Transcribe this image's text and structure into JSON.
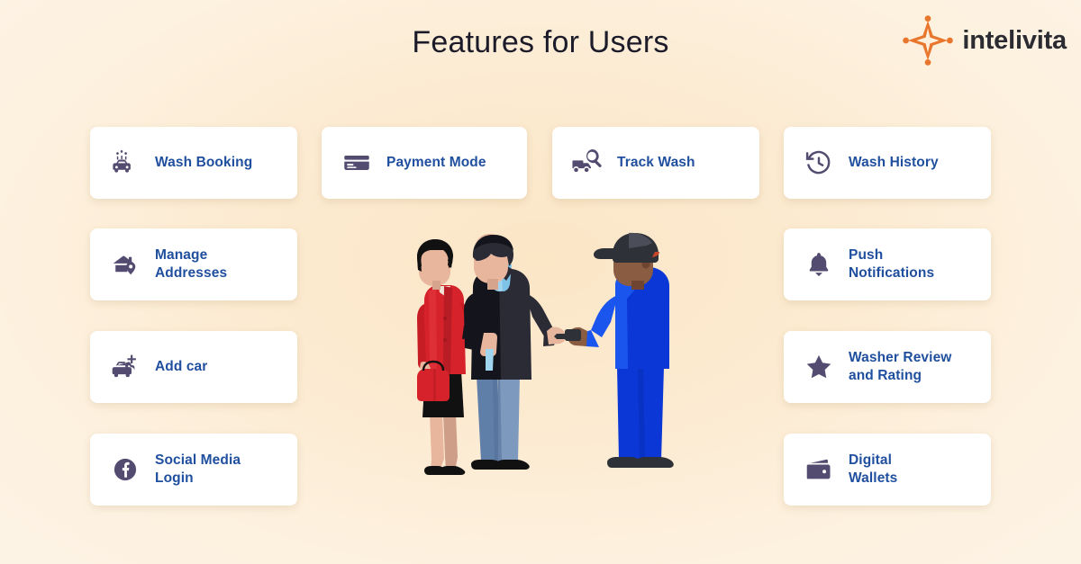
{
  "header": {
    "title": "Features for Users",
    "logo": {
      "wordmark": "intelivita",
      "mark_icon": "intelivita-star-icon",
      "mark_color": "#e8762c"
    }
  },
  "theme": {
    "background_top": "#fdf2e0",
    "background_mid": "#fbe8cd",
    "card_background": "#ffffff",
    "label_color": "#1f4f9e",
    "icon_color": "#544c70",
    "title_color": "#1c1b2a",
    "accent_orange": "#e8762c"
  },
  "features": {
    "left_column": [
      {
        "id": "wash-booking",
        "label": "Wash Booking",
        "icon": "car-wash-icon"
      },
      {
        "id": "manage-addresses",
        "label": "Manage\nAddresses",
        "icon": "home-pin-icon"
      },
      {
        "id": "add-car",
        "label": "Add car",
        "icon": "car-plus-icon"
      },
      {
        "id": "social-login",
        "label": "Social Media\nLogin",
        "icon": "facebook-icon"
      }
    ],
    "top_middle": [
      {
        "id": "payment-mode",
        "label": "Payment Mode",
        "icon": "credit-card-icon"
      },
      {
        "id": "track-wash",
        "label": "Track Wash",
        "icon": "truck-search-icon"
      }
    ],
    "right_column": [
      {
        "id": "wash-history",
        "label": "Wash History",
        "icon": "history-clock-icon"
      },
      {
        "id": "push-notifications",
        "label": "Push\nNotifications",
        "icon": "bell-icon"
      },
      {
        "id": "washer-review",
        "label": "Washer Review\nand Rating",
        "icon": "star-icon"
      },
      {
        "id": "digital-wallets",
        "label": "Digital\nWallets",
        "icon": "wallet-icon"
      }
    ]
  },
  "illustration": {
    "name": "car-key-handover-illustration",
    "description": "Couple receiving car keys from a car wash attendant",
    "figures": [
      {
        "role": "woman-customer",
        "jacket": "#d6222a",
        "skirt": "#111111",
        "bag": "#d6222a",
        "shoes": "#111111"
      },
      {
        "role": "man-customer",
        "coat": "#14141c",
        "scarf": "#9fd5ef",
        "jeans": "#5f7ea8",
        "shoes": "#111111"
      },
      {
        "role": "washer-attendant",
        "uniform": "#0a37d6",
        "cap": "#2f3138",
        "shoes": "#2f3138",
        "holding": "car-key"
      }
    ]
  }
}
